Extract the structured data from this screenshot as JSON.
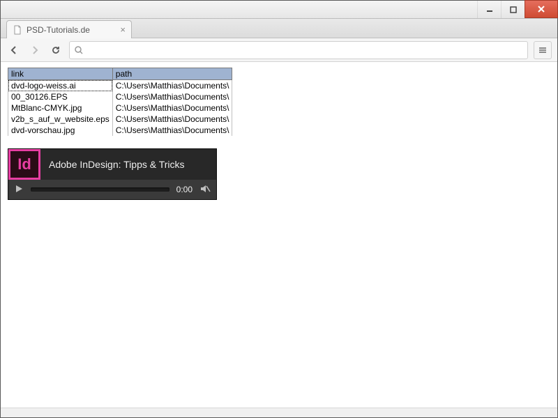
{
  "window": {
    "tab_title": "PSD-Tutorials.de"
  },
  "table": {
    "headers": {
      "link": "link",
      "path": "path"
    },
    "rows": [
      {
        "link": "dvd-logo-weiss.ai",
        "path": "C:\\Users\\Matthias\\Documents\\",
        "selected": true
      },
      {
        "link": "00_30126.EPS",
        "path": "C:\\Users\\Matthias\\Documents\\",
        "selected": false
      },
      {
        "link": "MtBlanc-CMYK.jpg",
        "path": "C:\\Users\\Matthias\\Documents\\",
        "selected": false
      },
      {
        "link": "v2b_s_auf_w_website.eps",
        "path": "C:\\Users\\Matthias\\Documents\\",
        "selected": false
      },
      {
        "link": "dvd-vorschau.jpg",
        "path": "C:\\Users\\Matthias\\Documents\\",
        "selected": false
      }
    ]
  },
  "player": {
    "badge": "Id",
    "title": "Adobe InDesign: Tipps & Tricks",
    "time": "0:00"
  }
}
